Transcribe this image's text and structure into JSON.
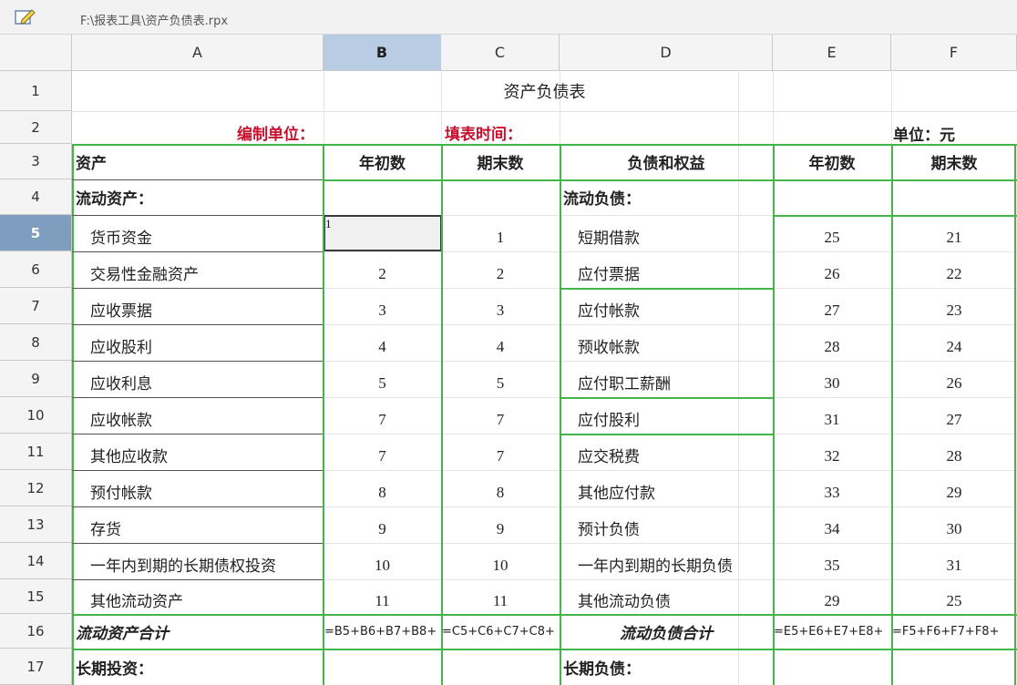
{
  "window": {
    "file_path": "F:\\报表工具\\资产负债表.rpx"
  },
  "icons": {
    "edit": "edit-pencil-icon"
  },
  "colors": {
    "accent_green": "#44b548",
    "red_label": "#c8102e",
    "selected_header": "#b8cce4",
    "selected_row": "#7f9dbf"
  },
  "selection": {
    "cell": "B5",
    "value": "1"
  },
  "columns": [
    "A",
    "B",
    "C",
    "D",
    "E",
    "F"
  ],
  "rows": [
    {
      "n": "1",
      "A": "",
      "B": "",
      "C": "",
      "D": "",
      "E": "",
      "F": ""
    },
    {
      "n": "2",
      "A": "",
      "B": "",
      "C": "",
      "D": "",
      "E": "",
      "F": ""
    },
    {
      "n": "3",
      "A": "",
      "B": "",
      "C": "",
      "D": "",
      "E": "",
      "F": ""
    },
    {
      "n": "4",
      "A": "",
      "B": "",
      "C": "",
      "D": "",
      "E": "",
      "F": ""
    },
    {
      "n": "5",
      "A": "",
      "B": "",
      "C": "",
      "D": "",
      "E": "",
      "F": ""
    },
    {
      "n": "6",
      "A": "",
      "B": "",
      "C": "",
      "D": "",
      "E": "",
      "F": ""
    },
    {
      "n": "7",
      "A": "",
      "B": "",
      "C": "",
      "D": "",
      "E": "",
      "F": ""
    },
    {
      "n": "8",
      "A": "",
      "B": "",
      "C": "",
      "D": "",
      "E": "",
      "F": ""
    },
    {
      "n": "9",
      "A": "",
      "B": "",
      "C": "",
      "D": "",
      "E": "",
      "F": ""
    },
    {
      "n": "10",
      "A": "",
      "B": "",
      "C": "",
      "D": "",
      "E": "",
      "F": ""
    },
    {
      "n": "11",
      "A": "",
      "B": "",
      "C": "",
      "D": "",
      "E": "",
      "F": ""
    },
    {
      "n": "12",
      "A": "",
      "B": "",
      "C": "",
      "D": "",
      "E": "",
      "F": ""
    },
    {
      "n": "13",
      "A": "",
      "B": "",
      "C": "",
      "D": "",
      "E": "",
      "F": ""
    },
    {
      "n": "14",
      "A": "",
      "B": "",
      "C": "",
      "D": "",
      "E": "",
      "F": ""
    },
    {
      "n": "15",
      "A": "",
      "B": "",
      "C": "",
      "D": "",
      "E": "",
      "F": ""
    },
    {
      "n": "16",
      "A": "",
      "B": "",
      "C": "",
      "D": "",
      "E": "",
      "F": ""
    },
    {
      "n": "17",
      "A": "",
      "B": "",
      "C": "",
      "D": "",
      "E": "",
      "F": ""
    }
  ],
  "report": {
    "title": "资产负债表",
    "unit_label": "编制单位：",
    "fill_time_label": "填表时间：",
    "unit_of_measure": "单位：元",
    "header": {
      "assets": "资产",
      "begin": "年初数",
      "end": "期末数",
      "liabilities": "负债和权益",
      "begin2": "年初数",
      "end2": "期末数"
    },
    "current_assets_label": "流动资产：",
    "current_liabilities_label": "流动负债：",
    "assets_items": [
      {
        "name": "货币资金",
        "begin": "",
        "end": "1"
      },
      {
        "name": "交易性金融资产",
        "begin": "2",
        "end": "2"
      },
      {
        "name": "应收票据",
        "begin": "3",
        "end": "3"
      },
      {
        "name": "应收股利",
        "begin": "4",
        "end": "4"
      },
      {
        "name": "应收利息",
        "begin": "5",
        "end": "5"
      },
      {
        "name": "应收帐款",
        "begin": "7",
        "end": "7"
      },
      {
        "name": "其他应收款",
        "begin": "7",
        "end": "7"
      },
      {
        "name": "预付帐款",
        "begin": "8",
        "end": "8"
      },
      {
        "name": "存货",
        "begin": "9",
        "end": "9"
      },
      {
        "name": "一年内到期的长期债权投资",
        "begin": "10",
        "end": "10"
      },
      {
        "name": "其他流动资产",
        "begin": "11",
        "end": "11"
      }
    ],
    "liability_items": [
      {
        "name": "短期借款",
        "begin": "25",
        "end": "21"
      },
      {
        "name": "应付票据",
        "begin": "26",
        "end": "22"
      },
      {
        "name": "应付帐款",
        "begin": "27",
        "end": "23"
      },
      {
        "name": "预收帐款",
        "begin": "28",
        "end": "24"
      },
      {
        "name": "应付职工薪酬",
        "begin": "30",
        "end": "26"
      },
      {
        "name": "应付股利",
        "begin": "31",
        "end": "27"
      },
      {
        "name": "应交税费",
        "begin": "32",
        "end": "28"
      },
      {
        "name": "其他应付款",
        "begin": "33",
        "end": "29"
      },
      {
        "name": "预计负债",
        "begin": "34",
        "end": "30"
      },
      {
        "name": "一年内到期的长期负债",
        "begin": "35",
        "end": "31"
      },
      {
        "name": "其他流动负债",
        "begin": "29",
        "end": "25"
      }
    ],
    "total_current_assets": "流动资产合计",
    "total_current_liabilities": "流动负债合计",
    "formula_b16": "=B5+B6+B7+B8+",
    "formula_c16": "=C5+C6+C7+C8+",
    "formula_e16": "=E5+E6+E7+E8+",
    "formula_f16": "=F5+F6+F7+F8+",
    "long_term_investment": "长期投资：",
    "long_term_liabilities": "长期负债："
  }
}
